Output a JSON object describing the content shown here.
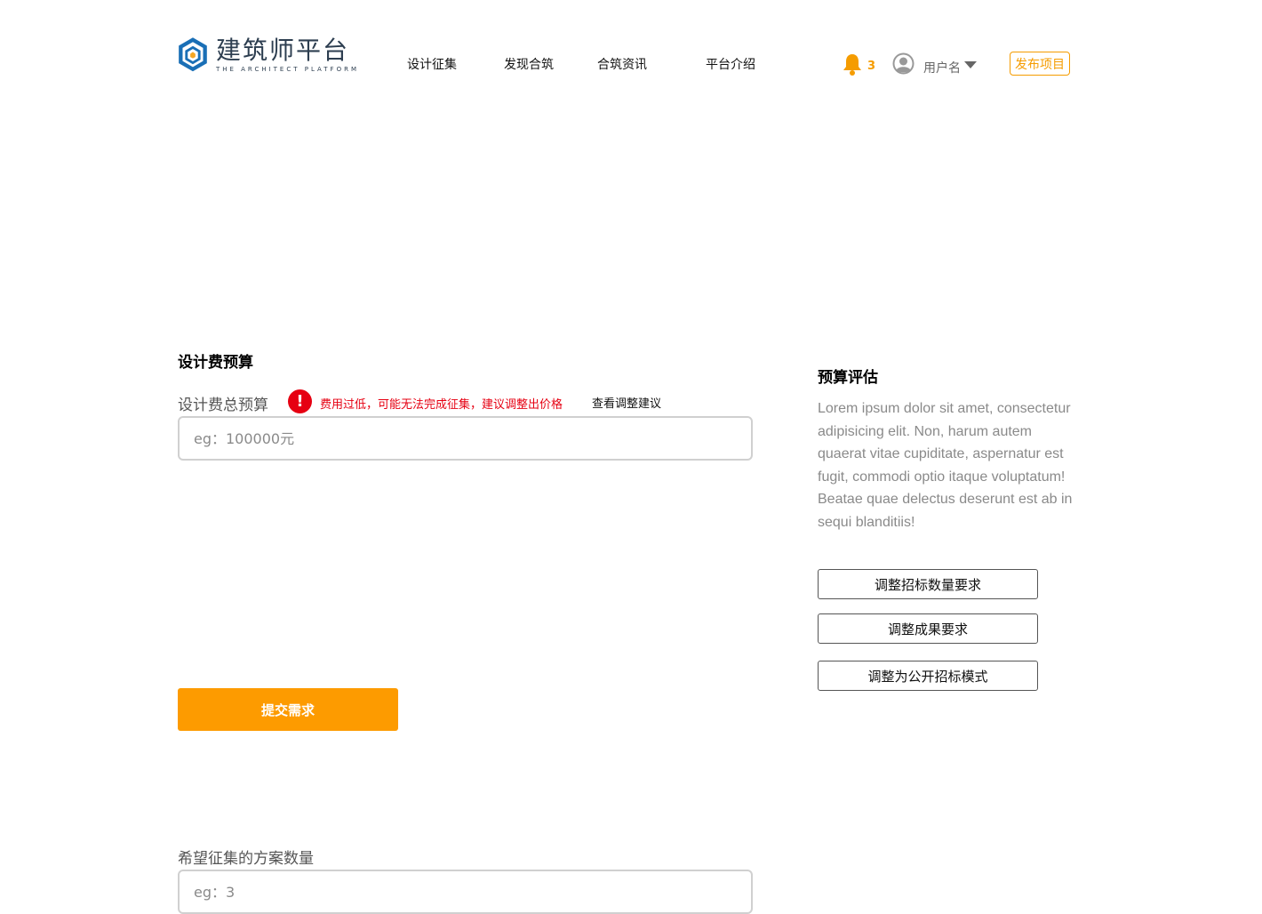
{
  "header": {
    "logo_cn": "建筑师平台",
    "logo_en": "THE ARCHITECT PLATFORM",
    "nav": [
      "设计征集",
      "发现合筑",
      "合筑资讯",
      "平台介绍"
    ],
    "notification_count": "3",
    "username": "用户名",
    "publish_label": "发布项目"
  },
  "budget": {
    "section_title": "设计费预算",
    "total_label": "设计费总预算",
    "warning_icon": "!",
    "warning_text": "费用过低，可能无法完成征集，建议调整出价格",
    "suggest_link": "查看调整建议",
    "total_placeholder": "eg：100000元"
  },
  "submit_label": "提交需求",
  "quantity": {
    "label": "希望征集的方案数量",
    "placeholder": "eg：3"
  },
  "evaluation": {
    "title": "预算评估",
    "body": "Lorem ipsum dolor sit amet, consectetur adipisicing elit. Non, harum autem quaerat vitae cupiditate, aspernatur est fugit, commodi optio itaque voluptatum! Beatae quae delectus deserunt est ab in sequi blanditiis!",
    "buttons": [
      "调整招标数量要求",
      "调整成果要求",
      "调整为公开招标模式"
    ]
  },
  "colors": {
    "accent": "#fd9b00",
    "warning": "#e60012",
    "logo_blue": "#1a6fb6"
  },
  "icons": [
    "logo-icon",
    "bell-icon",
    "avatar-icon",
    "chevron-down-icon",
    "warning-icon"
  ]
}
